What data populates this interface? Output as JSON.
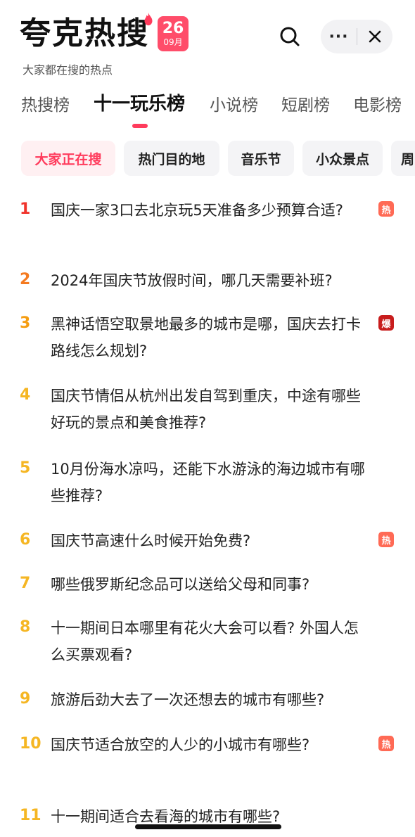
{
  "header": {
    "logo": "夸克热搜",
    "date_day": "26",
    "date_month": "09月",
    "subtitle": "大家都在搜的热点",
    "more_label": "···",
    "brand_color": "#ff3b5c"
  },
  "tabs": [
    {
      "label": "热搜榜"
    },
    {
      "label": "十一玩乐榜"
    },
    {
      "label": "小说榜"
    },
    {
      "label": "短剧榜"
    },
    {
      "label": "电影榜"
    }
  ],
  "chips": [
    {
      "label": "大家正在搜"
    },
    {
      "label": "热门目的地"
    },
    {
      "label": "音乐节"
    },
    {
      "label": "小众景点"
    },
    {
      "label": "周"
    }
  ],
  "list": [
    {
      "rank": "1",
      "title": "国庆一家3口去北京玩5天准备多少预算合适?",
      "tag": "热",
      "rank_color": "#f0342c",
      "tag_color": "#ff6a55"
    },
    {
      "rank": "2",
      "title": "2024年国庆节放假时间，哪几天需要补班?",
      "tag": "",
      "rank_color": "#f47a20",
      "tag_color": ""
    },
    {
      "rank": "3",
      "title": "黑神话悟空取景地最多的城市是哪，国庆去打卡路线怎么规划?",
      "tag": "爆",
      "rank_color": "#f59d12",
      "tag_color": "#c81d1d"
    },
    {
      "rank": "4",
      "title": "国庆节情侣从杭州出发自驾到重庆，中途有哪些好玩的景点和美食推荐?",
      "tag": "",
      "rank_color": "#f5b623",
      "tag_color": ""
    },
    {
      "rank": "5",
      "title": "10月份海水凉吗，还能下水游泳的海边城市有哪些推荐?",
      "tag": "",
      "rank_color": "#f5b623",
      "tag_color": ""
    },
    {
      "rank": "6",
      "title": "国庆节高速什么时候开始免费?",
      "tag": "热",
      "rank_color": "#f5b623",
      "tag_color": "#ff6a55"
    },
    {
      "rank": "7",
      "title": "哪些俄罗斯纪念品可以送给父母和同事?",
      "tag": "",
      "rank_color": "#f5b623",
      "tag_color": ""
    },
    {
      "rank": "8",
      "title": "十一期间日本哪里有花火大会可以看? 外国人怎么买票观看?",
      "tag": "",
      "rank_color": "#f5b623",
      "tag_color": ""
    },
    {
      "rank": "9",
      "title": "旅游后劲大去了一次还想去的城市有哪些?",
      "tag": "",
      "rank_color": "#f5b623",
      "tag_color": ""
    },
    {
      "rank": "10",
      "title": "国庆节适合放空的人少的小城市有哪些?",
      "tag": "热",
      "rank_color": "#f5b623",
      "tag_color": "#ff6a55"
    },
    {
      "rank": "11",
      "title": "十一期间适合去看海的城市有哪些?",
      "tag": "",
      "rank_color": "#f5b623",
      "tag_color": ""
    }
  ]
}
